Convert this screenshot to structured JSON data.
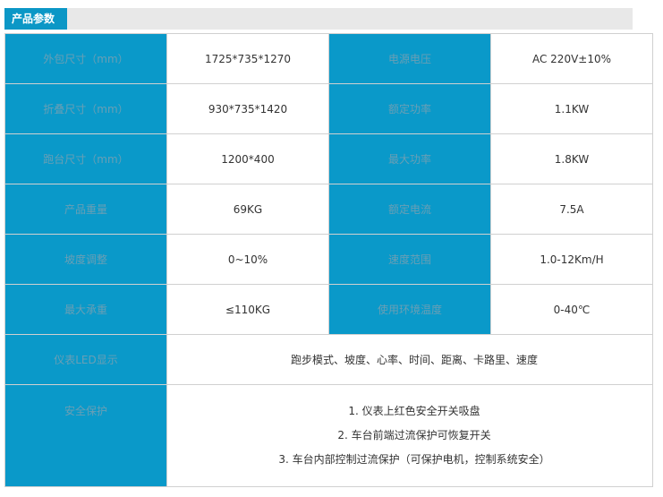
{
  "header": {
    "title": "产品参数"
  },
  "rows": [
    {
      "label_a": "外包尺寸（mm）",
      "value_a": "1725*735*1270",
      "label_b": "电源电压",
      "value_b": "AC 220V±10%"
    },
    {
      "label_a": "折叠尺寸（mm）",
      "value_a": "930*735*1420",
      "label_b": "额定功率",
      "value_b": "1.1KW"
    },
    {
      "label_a": "跑台尺寸（mm）",
      "value_a": "1200*400",
      "label_b": "最大功率",
      "value_b": "1.8KW"
    },
    {
      "label_a": "产品重量",
      "value_a": "69KG",
      "label_b": "额定电流",
      "value_b": "7.5A"
    },
    {
      "label_a": "坡度调整",
      "value_a": "0~10%",
      "label_b": "速度范围",
      "value_b": "1.0-12Km/H"
    },
    {
      "label_a": "最大承重",
      "value_a": "≤110KG",
      "label_b": "使用环境温度",
      "value_b": "0-40℃"
    }
  ],
  "display": {
    "label": "仪表LED显示",
    "value": "跑步模式、坡度、心率、时间、距离、卡路里、速度"
  },
  "safety": {
    "label": "安全保护",
    "items": [
      "1. 仪表上红色安全开关吸盘",
      "2. 车台前端过流保护可恢复开关",
      "3. 车台内部控制过流保护（可保护电机，控制系统安全）"
    ]
  }
}
